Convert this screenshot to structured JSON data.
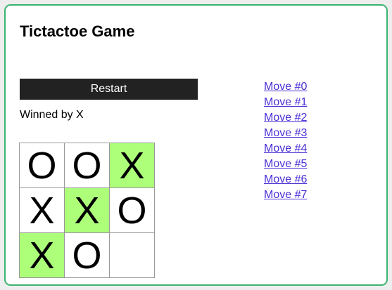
{
  "title": "Tictactoe Game",
  "restart_label": "Restart",
  "status": "Winned by X",
  "colors": {
    "border": "#3cb371",
    "win_highlight": "#adff7a",
    "button_bg": "#222222",
    "link": "#4a2fd6"
  },
  "board": {
    "cells": [
      "O",
      "O",
      "X",
      "X",
      "X",
      "O",
      "X",
      "O",
      ""
    ],
    "winning_cells": [
      2,
      4,
      6
    ]
  },
  "moves": [
    "Move #0",
    "Move #1",
    "Move #2",
    "Move #3",
    "Move #4",
    "Move #5",
    "Move #6",
    "Move #7"
  ]
}
